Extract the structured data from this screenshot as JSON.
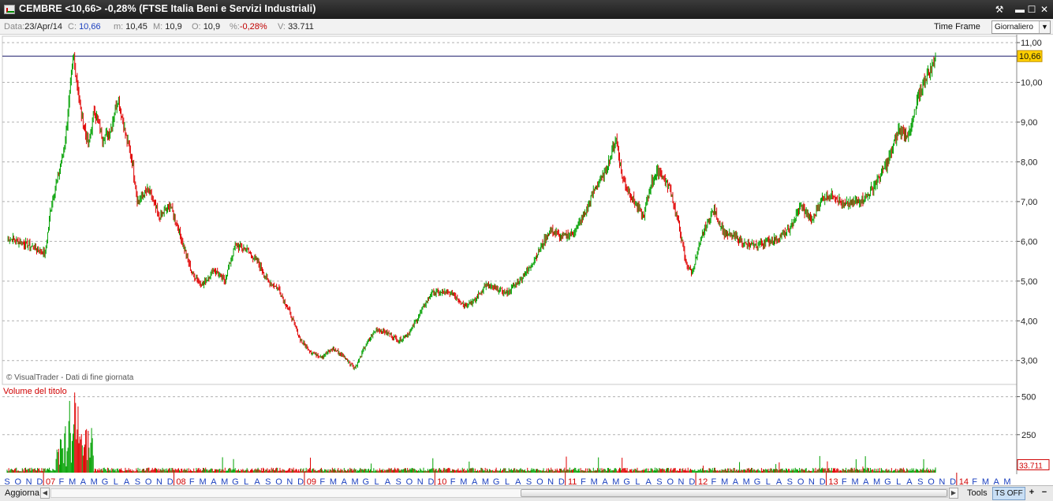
{
  "window": {
    "title": "CEMBRE <10,66> -0,28%  (FTSE Italia Beni e Servizi Industriali)",
    "buttons": {
      "tools_glyph": "⚒",
      "minimize": "▬",
      "maximize": "☐",
      "close": "✕"
    }
  },
  "info": {
    "date_label": "Data:",
    "date_value": "23/Apr/14",
    "close_label": "C:",
    "close_value": "10,66",
    "min_label": "m:",
    "min_value": "10,45",
    "max_label": "M:",
    "max_value": "10,9",
    "open_label": "O:",
    "open_value": "10,9",
    "pct_label": "%:",
    "pct_value": "-0,28%",
    "vol_label": "V:",
    "vol_value": "33.711",
    "timeframe_label": "Time Frame",
    "timeframe_value": "Giornaliero"
  },
  "bottom": {
    "refresh_label": "Aggiorna",
    "tools_label": "Tools",
    "ts_label": "TS OFF",
    "plus": "+",
    "minus": "−"
  },
  "colors": {
    "up": "#00a000",
    "down": "#e00000",
    "grid": "#b0b0b0",
    "last_price_bg": "#ffd000"
  },
  "chart_data": [
    {
      "type": "candlestick",
      "copyright": "© VisualTrader - Dati di fine giornata",
      "last_price_label": "10,66",
      "last_price": 10.66,
      "y_ticks": [
        "11,00",
        "10,00",
        "9,00",
        "8,00",
        "7,00",
        "6,00",
        "5,00",
        "4,00",
        "3,00"
      ],
      "y_tick_values": [
        11,
        10,
        9,
        8,
        7,
        6,
        5,
        4,
        3
      ],
      "ylim": [
        2.4,
        11.2
      ],
      "x_month_labels": [
        "S",
        "O",
        "N",
        "D",
        "07",
        "F",
        "M",
        "A",
        "M",
        "G",
        "L",
        "A",
        "S",
        "O",
        "N",
        "D",
        "08",
        "F",
        "M",
        "A",
        "M",
        "G",
        "L",
        "A",
        "S",
        "O",
        "N",
        "D",
        "09",
        "F",
        "M",
        "A",
        "M",
        "G",
        "L",
        "A",
        "S",
        "O",
        "N",
        "D",
        "10",
        "F",
        "M",
        "A",
        "M",
        "G",
        "L",
        "A",
        "S",
        "O",
        "N",
        "D",
        "11",
        "F",
        "M",
        "A",
        "M",
        "G",
        "L",
        "A",
        "S",
        "O",
        "N",
        "D",
        "12",
        "F",
        "M",
        "A",
        "M",
        "G",
        "L",
        "A",
        "S",
        "O",
        "N",
        "D",
        "13",
        "F",
        "M",
        "A",
        "M",
        "G",
        "L",
        "A",
        "S",
        "O",
        "N",
        "D",
        "14",
        "F",
        "M",
        "A",
        "M"
      ],
      "x_start": "2006-09",
      "x_end": "2014-04",
      "price_path": [
        {
          "m": 0,
          "v": 6.1
        },
        {
          "m": 2,
          "v": 5.9
        },
        {
          "m": 3.5,
          "v": 5.7
        },
        {
          "m": 4,
          "v": 6.8
        },
        {
          "m": 5.3,
          "v": 8.4
        },
        {
          "m": 6.1,
          "v": 10.7
        },
        {
          "m": 6.8,
          "v": 9.2
        },
        {
          "m": 7.5,
          "v": 8.4
        },
        {
          "m": 8,
          "v": 9.3
        },
        {
          "m": 8.8,
          "v": 8.6
        },
        {
          "m": 9.5,
          "v": 8.8
        },
        {
          "m": 10.2,
          "v": 9.6
        },
        {
          "m": 10.8,
          "v": 8.8
        },
        {
          "m": 11.5,
          "v": 8.0
        },
        {
          "m": 12,
          "v": 7.0
        },
        {
          "m": 13,
          "v": 7.3
        },
        {
          "m": 14,
          "v": 6.6
        },
        {
          "m": 15,
          "v": 6.9
        },
        {
          "m": 16,
          "v": 6.1
        },
        {
          "m": 17,
          "v": 5.2
        },
        {
          "m": 18,
          "v": 4.9
        },
        {
          "m": 19,
          "v": 5.3
        },
        {
          "m": 20,
          "v": 5.0
        },
        {
          "m": 21,
          "v": 5.9
        },
        {
          "m": 22,
          "v": 5.8
        },
        {
          "m": 23,
          "v": 5.5
        },
        {
          "m": 24,
          "v": 5.0
        },
        {
          "m": 25,
          "v": 4.8
        },
        {
          "m": 26,
          "v": 4.2
        },
        {
          "m": 27,
          "v": 3.5
        },
        {
          "m": 28,
          "v": 3.2
        },
        {
          "m": 29,
          "v": 3.1
        },
        {
          "m": 30,
          "v": 3.3
        },
        {
          "m": 31,
          "v": 3.1
        },
        {
          "m": 32,
          "v": 2.8
        },
        {
          "m": 33,
          "v": 3.4
        },
        {
          "m": 34,
          "v": 3.8
        },
        {
          "m": 35,
          "v": 3.7
        },
        {
          "m": 36,
          "v": 3.5
        },
        {
          "m": 37,
          "v": 3.7
        },
        {
          "m": 38,
          "v": 4.2
        },
        {
          "m": 39,
          "v": 4.7
        },
        {
          "m": 40,
          "v": 4.7
        },
        {
          "m": 41,
          "v": 4.7
        },
        {
          "m": 42,
          "v": 4.4
        },
        {
          "m": 43,
          "v": 4.5
        },
        {
          "m": 44,
          "v": 4.9
        },
        {
          "m": 45,
          "v": 4.8
        },
        {
          "m": 46,
          "v": 4.7
        },
        {
          "m": 47,
          "v": 5.0
        },
        {
          "m": 48,
          "v": 5.3
        },
        {
          "m": 49,
          "v": 5.8
        },
        {
          "m": 50,
          "v": 6.3
        },
        {
          "m": 51,
          "v": 6.1
        },
        {
          "m": 52,
          "v": 6.2
        },
        {
          "m": 53,
          "v": 6.6
        },
        {
          "m": 54,
          "v": 7.3
        },
        {
          "m": 55,
          "v": 7.7
        },
        {
          "m": 56,
          "v": 8.6
        },
        {
          "m": 56.6,
          "v": 7.6
        },
        {
          "m": 57.5,
          "v": 7.1
        },
        {
          "m": 58.5,
          "v": 6.6
        },
        {
          "m": 59.3,
          "v": 7.5
        },
        {
          "m": 60,
          "v": 7.8
        },
        {
          "m": 61,
          "v": 7.3
        },
        {
          "m": 61.8,
          "v": 6.4
        },
        {
          "m": 62.4,
          "v": 5.5
        },
        {
          "m": 63,
          "v": 5.2
        },
        {
          "m": 64,
          "v": 6.2
        },
        {
          "m": 65,
          "v": 6.8
        },
        {
          "m": 66,
          "v": 6.2
        },
        {
          "m": 67,
          "v": 6.1
        },
        {
          "m": 68,
          "v": 5.9
        },
        {
          "m": 69,
          "v": 5.9
        },
        {
          "m": 70,
          "v": 6.0
        },
        {
          "m": 71,
          "v": 6.1
        },
        {
          "m": 72,
          "v": 6.3
        },
        {
          "m": 73,
          "v": 6.9
        },
        {
          "m": 74,
          "v": 6.5
        },
        {
          "m": 75,
          "v": 7.1
        },
        {
          "m": 76,
          "v": 7.2
        },
        {
          "m": 77,
          "v": 6.9
        },
        {
          "m": 78,
          "v": 7.0
        },
        {
          "m": 79,
          "v": 7.1
        },
        {
          "m": 80,
          "v": 7.5
        },
        {
          "m": 81,
          "v": 8.0
        },
        {
          "m": 82,
          "v": 8.8
        },
        {
          "m": 83,
          "v": 8.7
        },
        {
          "m": 84,
          "v": 9.8
        },
        {
          "m": 84.6,
          "v": 10.2
        },
        {
          "m": 85,
          "v": 10.3
        },
        {
          "m": 85.4,
          "v": 10.66
        }
      ],
      "volume_axis_ticks": [
        "500",
        "250"
      ],
      "volume_axis_values": [
        500,
        250
      ],
      "volume_ylim": [
        0,
        560
      ],
      "volume_label": "Volume del titolo",
      "volume_last_label": "33.711"
    }
  ]
}
